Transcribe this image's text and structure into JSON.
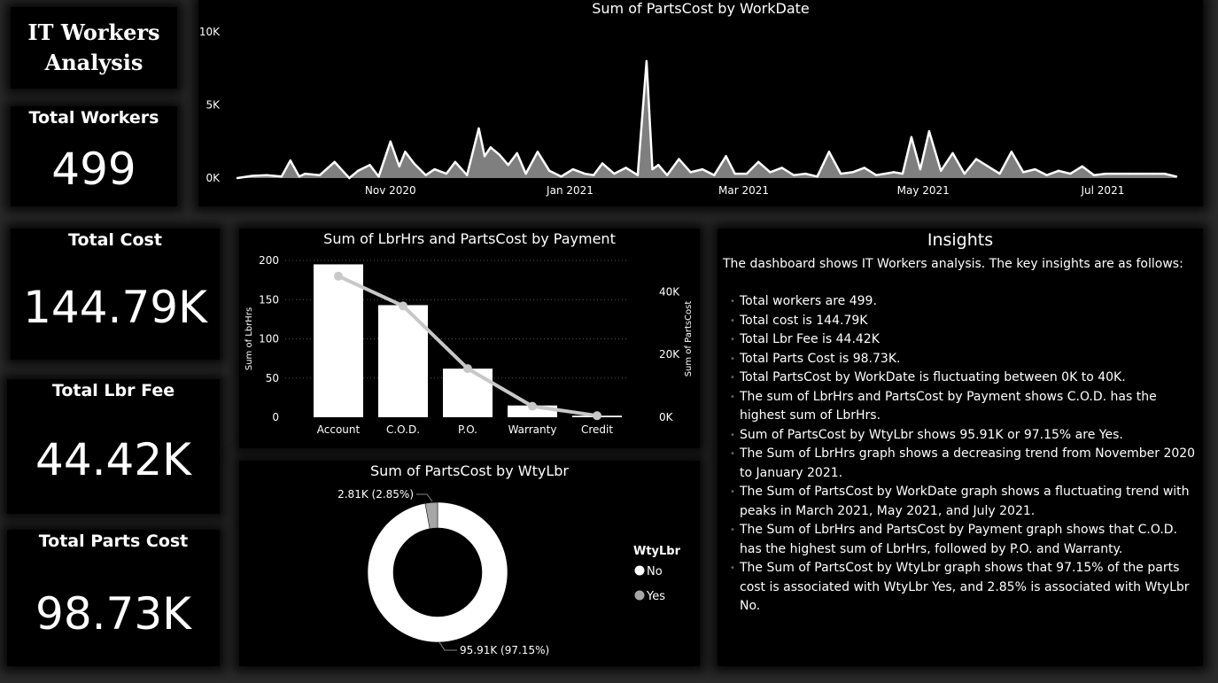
{
  "dashboard": {
    "title_line1": "IT Workers",
    "title_line2": "Analysis"
  },
  "kpis": {
    "workers": {
      "label": "Total Workers",
      "value": "499"
    },
    "cost": {
      "label": "Total Cost",
      "value": "144.79K"
    },
    "lbr_fee": {
      "label": "Total Lbr Fee",
      "value": "44.42K"
    },
    "parts_cost": {
      "label": "Total Parts Cost",
      "value": "98.73K"
    }
  },
  "colors": {
    "background": "#000000",
    "area_fill": "#7f7f7f",
    "line": "#ffffff",
    "bar": "#ffffff",
    "line_series": "#c8c8c8",
    "donut_yes": "#a6a6a6",
    "donut_no": "#ffffff"
  },
  "insights": {
    "title": "Insights",
    "intro": "The dashboard shows IT Workers analysis. The key insights are as follows:",
    "items": [
      "Total workers are 499.",
      "Total cost is 144.79K",
      "Total Lbr Fee is 44.42K",
      "Total Parts Cost is 98.73K.",
      "Total PartsCost by WorkDate is fluctuating between 0K to 40K.",
      "The sum of LbrHrs and PartsCost by Payment shows C.O.D. has the highest sum of LbrHrs.",
      "Sum of PartsCost by WtyLbr shows 95.91K or 97.15% are Yes.",
      "The Sum of LbrHrs graph shows a decreasing trend from November 2020 to January 2021.",
      "The Sum of PartsCost by WorkDate graph shows a fluctuating trend with peaks in March 2021, May 2021, and July 2021.",
      "The Sum of LbrHrs and PartsCost by Payment graph shows that C.O.D. has the highest sum of LbrHrs, followed by P.O. and Warranty.",
      "The Sum of PartsCost by WtyLbr graph shows that 97.15% of the parts cost is associated with WtyLbr Yes, and 2.85% is associated with WtyLbr No."
    ]
  },
  "chart_data": [
    {
      "type": "area",
      "title": "Sum of PartsCost by WorkDate",
      "xlabel": "",
      "ylabel": "",
      "x_tick_labels": [
        "Nov 2020",
        "Jan 2021",
        "Mar 2021",
        "May 2021",
        "Jul 2021"
      ],
      "y_tick_labels": [
        "0K",
        "5K",
        "10K"
      ],
      "ylim": [
        0,
        10000
      ],
      "x": [
        "2020-09-10",
        "2020-09-15",
        "2020-09-20",
        "2020-09-25",
        "2020-09-28",
        "2020-10-01",
        "2020-10-03",
        "2020-10-08",
        "2020-10-13",
        "2020-10-18",
        "2020-10-21",
        "2020-10-25",
        "2020-10-28",
        "2020-11-01",
        "2020-11-04",
        "2020-11-06",
        "2020-11-09",
        "2020-11-13",
        "2020-11-16",
        "2020-11-20",
        "2020-11-23",
        "2020-11-27",
        "2020-12-01",
        "2020-12-03",
        "2020-12-05",
        "2020-12-08",
        "2020-12-11",
        "2020-12-14",
        "2020-12-17",
        "2020-12-21",
        "2020-12-25",
        "2020-12-29",
        "2021-01-02",
        "2021-01-06",
        "2021-01-09",
        "2021-01-12",
        "2021-01-16",
        "2021-01-20",
        "2021-01-24",
        "2021-01-27",
        "2021-01-29",
        "2021-01-31",
        "2021-02-03",
        "2021-02-07",
        "2021-02-11",
        "2021-02-15",
        "2021-02-19",
        "2021-02-23",
        "2021-02-26",
        "2021-03-02",
        "2021-03-06",
        "2021-03-10",
        "2021-03-14",
        "2021-03-18",
        "2021-03-22",
        "2021-03-26",
        "2021-03-30",
        "2021-04-03",
        "2021-04-07",
        "2021-04-11",
        "2021-04-15",
        "2021-04-18",
        "2021-04-21",
        "2021-04-24",
        "2021-04-27",
        "2021-04-30",
        "2021-05-03",
        "2021-05-07",
        "2021-05-11",
        "2021-05-15",
        "2021-05-19",
        "2021-05-23",
        "2021-05-27",
        "2021-05-31",
        "2021-06-04",
        "2021-06-08",
        "2021-06-12",
        "2021-06-16",
        "2021-06-20",
        "2021-06-24",
        "2021-06-28",
        "2021-07-02",
        "2021-07-06",
        "2021-07-10",
        "2021-07-14",
        "2021-07-18",
        "2021-07-22",
        "2021-07-26"
      ],
      "values": [
        0,
        150,
        200,
        100,
        1200,
        100,
        300,
        200,
        1100,
        0,
        500,
        900,
        100,
        2500,
        800,
        1800,
        1000,
        200,
        600,
        300,
        1100,
        200,
        3400,
        1500,
        2100,
        1600,
        900,
        1700,
        300,
        1800,
        500,
        100,
        600,
        300,
        200,
        1000,
        300,
        700,
        200,
        8000,
        600,
        900,
        200,
        1300,
        400,
        600,
        200,
        1500,
        300,
        300,
        1100,
        400,
        700,
        200,
        300,
        100,
        1800,
        300,
        400,
        700,
        200,
        300,
        400,
        300,
        2800,
        600,
        3200,
        500,
        1700,
        300,
        1300,
        800,
        300,
        1800,
        400,
        600,
        200,
        500,
        300,
        800,
        200,
        300,
        300,
        300,
        300,
        300,
        300,
        100
      ]
    },
    {
      "type": "bar",
      "title": "Sum of LbrHrs and PartsCost by Payment",
      "categories": [
        "Account",
        "C.O.D.",
        "P.O.",
        "Warranty",
        "Credit"
      ],
      "ylabel": "Sum of LbrHrs",
      "y2label": "Sum of PartsCost",
      "ylim": [
        0,
        200
      ],
      "y2lim": [
        0,
        50000
      ],
      "y_ticks": [
        0,
        50,
        100,
        150,
        200
      ],
      "y2_tick_labels": [
        "0K",
        "20K",
        "40K"
      ],
      "series": [
        {
          "name": "Sum of LbrHrs",
          "kind": "bar",
          "values": [
            195,
            143,
            62,
            15,
            2
          ]
        },
        {
          "name": "Sum of PartsCost",
          "kind": "line",
          "values": [
            45000,
            35500,
            15500,
            3500,
            500
          ]
        }
      ]
    },
    {
      "type": "pie",
      "title": "Sum of PartsCost by WtyLbr",
      "legend_title": "WtyLbr",
      "labels": [
        "No",
        "Yes"
      ],
      "values": [
        95.91,
        2.81
      ],
      "data_labels": [
        "95.91K (97.15%)",
        "2.81K (2.85%)"
      ],
      "donut": true,
      "legend": "right"
    }
  ]
}
